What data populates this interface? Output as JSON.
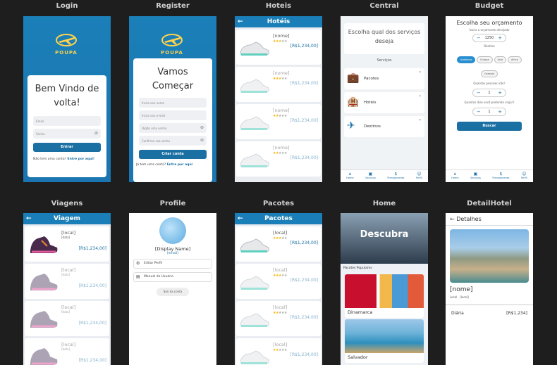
{
  "screens": {
    "login": {
      "title": "Login",
      "logo_text": "POUPA",
      "welcome": "Bem Vindo de volta!",
      "email_placeholder": "Email",
      "password_placeholder": "Senha",
      "button": "Entrar",
      "no_account": "Não tem uma conta?",
      "link": "Entre por aqui!"
    },
    "register": {
      "title": "Register",
      "logo_text": "POUPA",
      "heading": "Vamos Começar",
      "name_placeholder": "Insira seu nome",
      "email_placeholder": "Insira seu e-mail",
      "password_placeholder": "Digite uma senha",
      "confirm_placeholder": "Confirme sua senha",
      "button": "Criar conta",
      "have_account": "Já tem uma conta?",
      "link": "Entre por aqui"
    },
    "hoteis": {
      "title": "Hoteis",
      "header": "Hotéis",
      "items": [
        {
          "name": "[nome]",
          "price": "[R$1,234,00]"
        },
        {
          "name": "[nome]",
          "price": "[R$1,234,00]"
        },
        {
          "name": "[nome]",
          "price": "[R$1,234,00]"
        },
        {
          "name": "[nome]",
          "price": "[R$1,234,00]"
        }
      ]
    },
    "central": {
      "title": "Central",
      "prompt": "Escolha qual dos serviços deseja",
      "section": "Serviços",
      "services": [
        "Pacotes",
        "Hotéis",
        "Destinos"
      ],
      "nav": [
        "Home",
        "Serviços",
        "Planejamento",
        "Perfil"
      ]
    },
    "budget": {
      "title": "Budget",
      "heading": "Escolha seu orçamento",
      "budget_label": "Insira o orçamento desejado",
      "budget_value": "1250",
      "dest_label": "Destino",
      "destinations": [
        "Américas",
        "Europa",
        "Ásia",
        "Africa",
        "Oceania"
      ],
      "people_label": "Quantas pessoas irão?",
      "people_value": "1",
      "days_label": "Quantos dias você pretende viajar?",
      "days_value": "1",
      "button": "Buscar",
      "nav": [
        "Home",
        "Serviços",
        "Planejamento",
        "Perfil"
      ]
    },
    "viagens": {
      "title": "Viagens",
      "header": "Viagem",
      "items": [
        {
          "name": "[local]",
          "sub": "[data]",
          "price": "[R$1,234,00]"
        },
        {
          "name": "[local]",
          "sub": "[data]",
          "price": "[R$1,234,00]"
        },
        {
          "name": "[local]",
          "sub": "[data]",
          "price": "[R$1,234,00]"
        },
        {
          "name": "[local]",
          "sub": "[data]",
          "price": "[R$1,234,00]"
        }
      ]
    },
    "profile": {
      "title": "Profile",
      "display_name": "[Display Name]",
      "email": "[email]",
      "edit": "Editar Perfil",
      "manual": "Manual do Usuário",
      "logout": "Sair da conta"
    },
    "pacotes": {
      "title": "Pacotes",
      "header": "Pacotes",
      "items": [
        {
          "name": "[local]",
          "price": "[R$1,234,00]"
        },
        {
          "name": "[local]",
          "price": "[R$1,234,00]"
        },
        {
          "name": "[local]",
          "price": "[R$1,234,00]"
        },
        {
          "name": "[local]",
          "price": "[R$1,234,00]"
        }
      ]
    },
    "home": {
      "title": "Home",
      "hero": "Descubra",
      "popular": "Pacotes Populares",
      "destinations": [
        "Dinamarca",
        "Salvador"
      ]
    },
    "detail": {
      "title": "DetailHotel",
      "header": "Detalhes",
      "name": "[nome]",
      "local_label": "Local",
      "local_value": "[local]",
      "price_label": "Diária",
      "price_value": "[R$1,234]"
    }
  }
}
